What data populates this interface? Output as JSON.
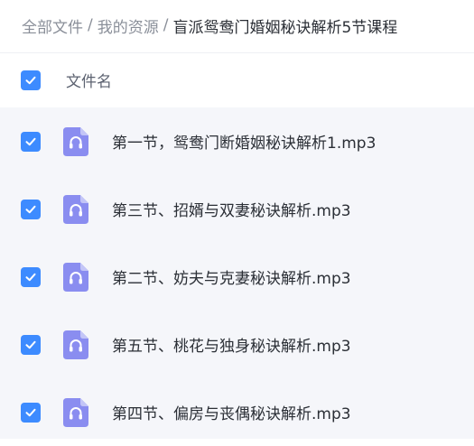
{
  "breadcrumb": {
    "items": [
      "全部文件",
      "我的资源"
    ],
    "separator": "/",
    "current": "盲派鸳鸯门婚姻秘诀解析5节课程"
  },
  "list_header": {
    "column_label": "文件名",
    "select_all_checked": true
  },
  "files": [
    {
      "name": "第一节，鸳鸯门断婚姻秘诀解析1.mp3",
      "checked": true,
      "icon": "audio-file-icon"
    },
    {
      "name": "第三节、招婿与双妻秘诀解析.mp3",
      "checked": true,
      "icon": "audio-file-icon"
    },
    {
      "name": "第二节、妨夫与克妻秘诀解析.mp3",
      "checked": true,
      "icon": "audio-file-icon"
    },
    {
      "name": "第五节、桃花与独身秘诀解析.mp3",
      "checked": true,
      "icon": "audio-file-icon"
    },
    {
      "name": "第四节、偏房与丧偶秘诀解析.mp3",
      "checked": true,
      "icon": "audio-file-icon"
    }
  ],
  "colors": {
    "checkbox": "#3d8bff",
    "audio_icon": "#8a8df0",
    "list_background": "#f5f6fa"
  }
}
